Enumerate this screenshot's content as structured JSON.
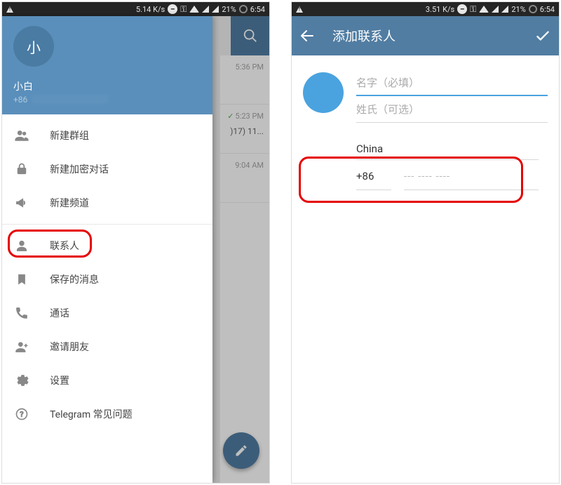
{
  "status_left": {
    "speed": "5.14 K/s",
    "speed_right": "3.51 K/s"
  },
  "status_right": {
    "battery": "21%",
    "time": "6:54"
  },
  "drawer": {
    "avatar_initial": "小",
    "name": "小白",
    "phone": "+86",
    "items": [
      {
        "label": "新建群组"
      },
      {
        "label": "新建加密对话"
      },
      {
        "label": "新建频道"
      },
      {
        "label": "联系人"
      },
      {
        "label": "保存的消息"
      },
      {
        "label": "通话"
      },
      {
        "label": "邀请朋友"
      },
      {
        "label": "设置"
      },
      {
        "label": "Telegram 常见问题"
      }
    ]
  },
  "chats": [
    {
      "time": "5:36 PM",
      "extra": ""
    },
    {
      "time": "5:23 PM",
      "extra": ")17) 11...",
      "checked": true
    },
    {
      "time": "9:04 AM",
      "extra": ""
    }
  ],
  "addcontact": {
    "title": "添加联系人",
    "first_name_ph": "名字（必填）",
    "last_name_ph": "姓氏（可选）",
    "country": "China",
    "country_code": "+86",
    "phone_ph": "--- ---- ----"
  }
}
